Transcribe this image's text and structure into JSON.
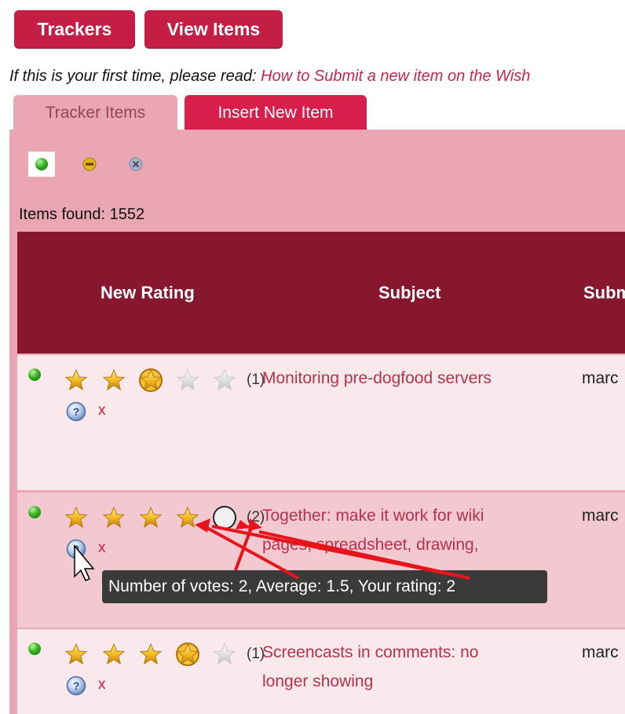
{
  "toolbar": {
    "trackers_label": "Trackers",
    "view_items_label": "View Items"
  },
  "intro": {
    "prefix": "If this is your first time, please read:",
    "link": "How to Submit a new item on the Wish"
  },
  "tabs": [
    {
      "label": "Tracker Items",
      "active": true
    },
    {
      "label": "Insert New Item",
      "active": false
    }
  ],
  "filters": [
    {
      "icon": "green-dot-icon",
      "selected": true
    },
    {
      "icon": "yellow-minus-icon",
      "selected": false
    },
    {
      "icon": "grey-x-icon",
      "selected": false
    }
  ],
  "items_found": "Items found: 1552",
  "columns": [
    "New Rating",
    "Subject",
    "Subm"
  ],
  "rows": [
    {
      "rating": 2,
      "count": "(1)",
      "subject_lines": [
        "Monitoring pre-dogfood servers"
      ],
      "submitter": "marc",
      "x": "x"
    },
    {
      "rating": 4,
      "count": "(2)",
      "subject_lines": [
        "Together: make it work for wiki",
        "pages, spreadsheet, drawing,"
      ],
      "submitter": "marc",
      "x": "x"
    },
    {
      "rating": 3,
      "count": "(1)",
      "subject_lines": [
        "Screencasts in comments: no",
        "longer showing"
      ],
      "submitter": "marc",
      "x": "x"
    }
  ],
  "tooltip": "Number of votes: 2, Average: 1.5, Your rating: 2",
  "colors": {
    "button": "#c41e45",
    "panel": "#eaa6b2",
    "header": "#87172f",
    "row_light": "#f9e9ec",
    "row_pink": "#f3c9d1",
    "link": "#b8314e",
    "arrow": "#e8141b"
  }
}
